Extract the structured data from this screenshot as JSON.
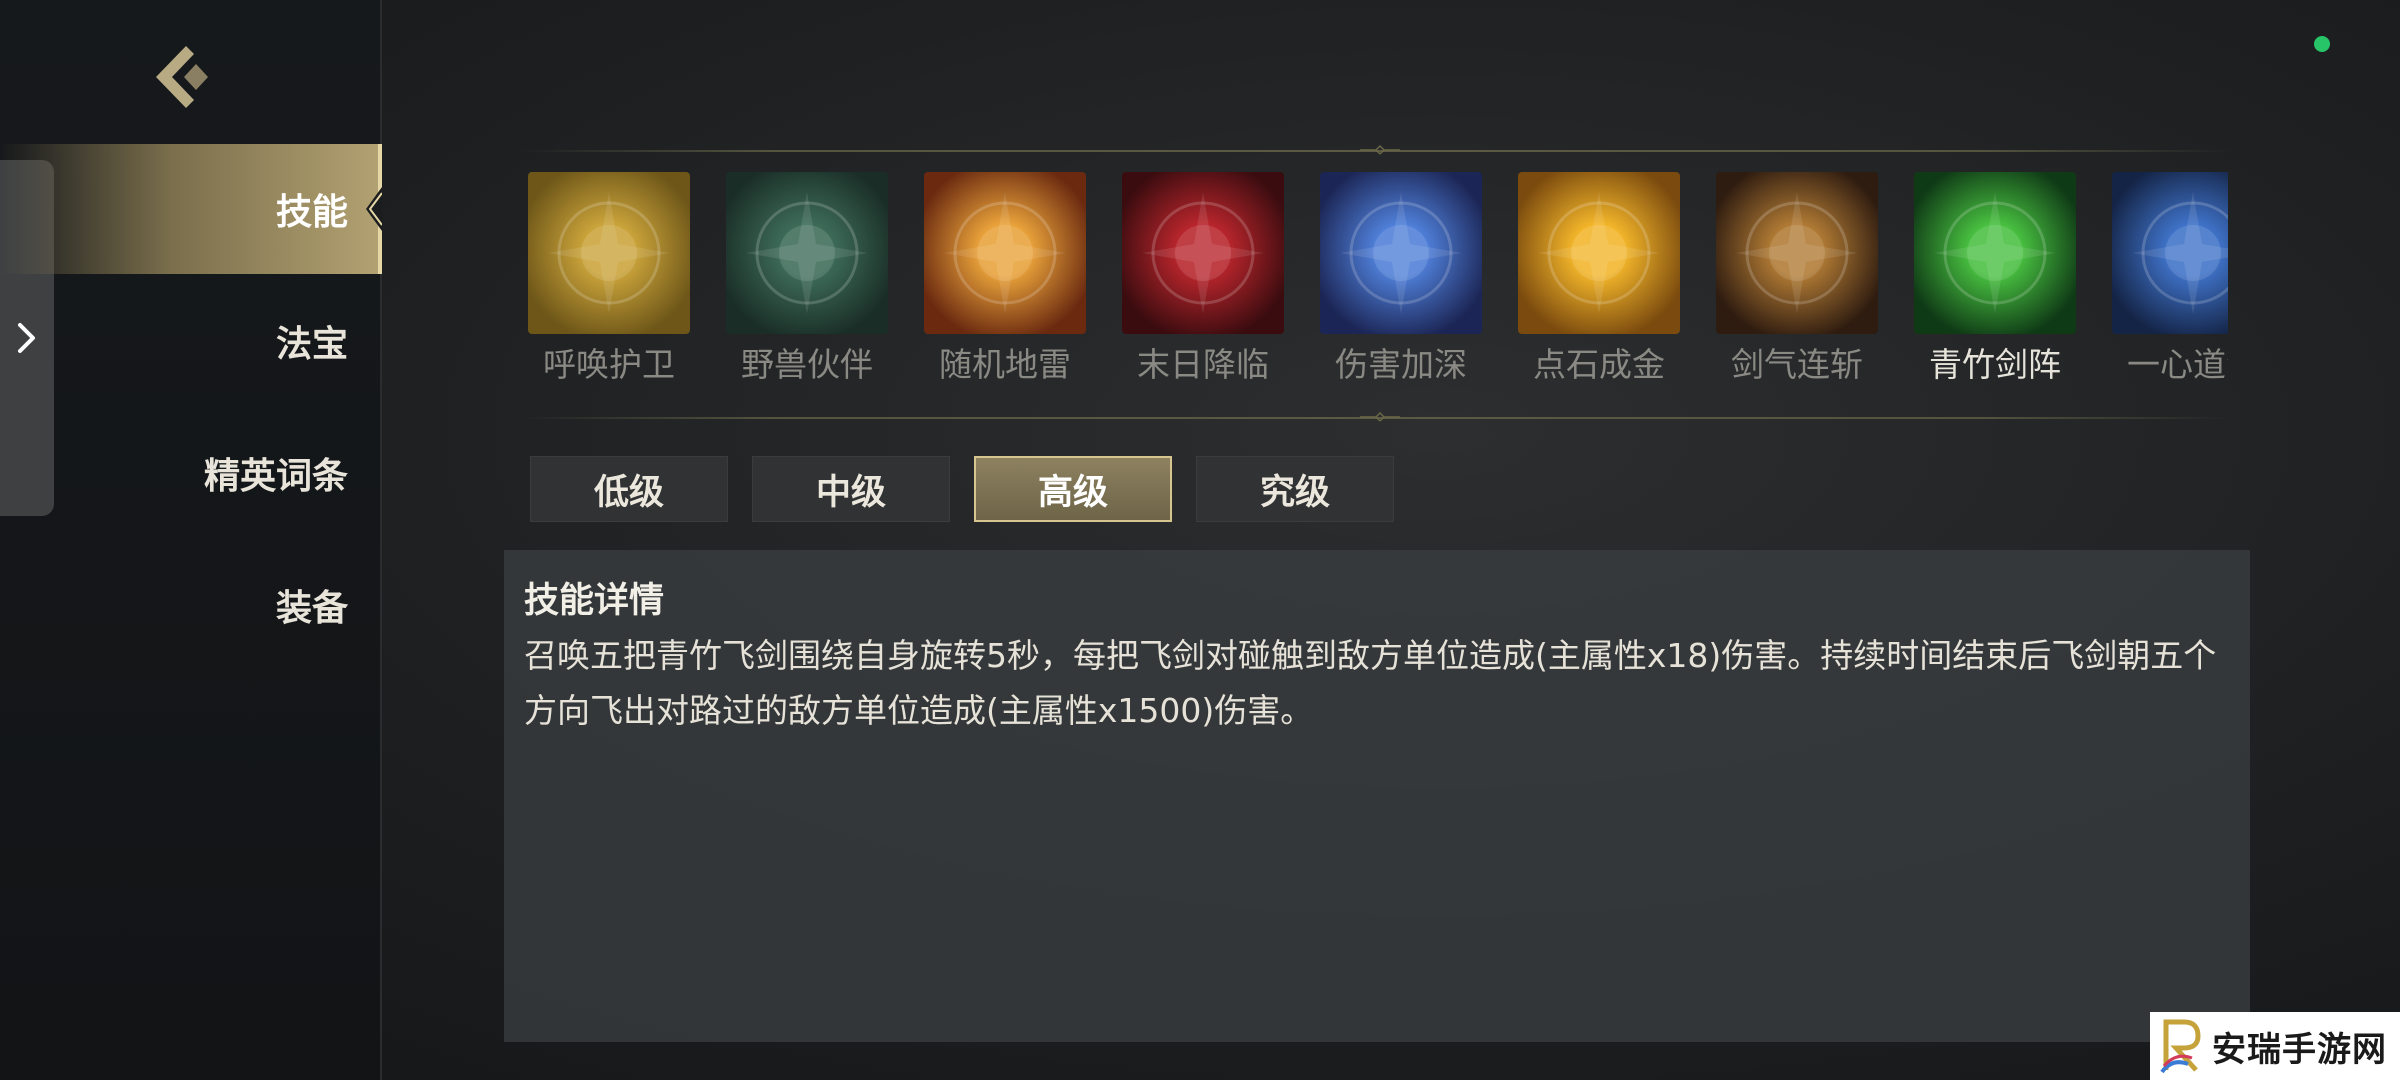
{
  "sidebar": {
    "items": [
      {
        "label": "技能",
        "active": true
      },
      {
        "label": "法宝",
        "active": false
      },
      {
        "label": "精英词条",
        "active": false
      },
      {
        "label": "装备",
        "active": false
      }
    ]
  },
  "skills": [
    {
      "name": "呼唤护卫",
      "icon": "guardian-summon-icon",
      "colors": [
        "#caa33a",
        "#6d5618"
      ]
    },
    {
      "name": "野兽伙伴",
      "icon": "beast-companion-icon",
      "colors": [
        "#3d6b58",
        "#1a2e27"
      ]
    },
    {
      "name": "随机地雷",
      "icon": "random-mine-icon",
      "colors": [
        "#e9a23a",
        "#6b2a10"
      ]
    },
    {
      "name": "末日降临",
      "icon": "doomsday-icon",
      "colors": [
        "#b8252c",
        "#3a0c0f"
      ]
    },
    {
      "name": "伤害加深",
      "icon": "damage-amplify-icon",
      "colors": [
        "#4f7fd8",
        "#1c2656"
      ]
    },
    {
      "name": "点石成金",
      "icon": "golden-touch-icon",
      "colors": [
        "#f2b52a",
        "#7a4a0e"
      ]
    },
    {
      "name": "剑气连斩",
      "icon": "sword-slash-icon",
      "colors": [
        "#b07a34",
        "#2f1c10"
      ]
    },
    {
      "name": "青竹剑阵",
      "icon": "bamboo-sword-array-icon",
      "colors": [
        "#48c040",
        "#0f3a16"
      ],
      "selected": true
    },
    {
      "name": "一心道法",
      "icon": "one-heart-dao-icon",
      "colors": [
        "#3f72c8",
        "#142446"
      ]
    }
  ],
  "tiers": [
    {
      "label": "低级",
      "active": false
    },
    {
      "label": "中级",
      "active": false
    },
    {
      "label": "高级",
      "active": true
    },
    {
      "label": "究级",
      "active": false
    }
  ],
  "detail": {
    "title": "技能详情",
    "description": "召唤五把青竹飞剑围绕自身旋转5秒，每把飞剑对碰触到敌方单位造成(主属性x18)伤害。持续时间结束后飞剑朝五个方向飞出对路过的敌方单位造成(主属性x1500)伤害。"
  },
  "watermark": {
    "text": "安瑞手游网",
    "logo_letter": "R"
  },
  "colors": {
    "accent_gold": "#d6c58f",
    "status_green": "#27c567"
  }
}
